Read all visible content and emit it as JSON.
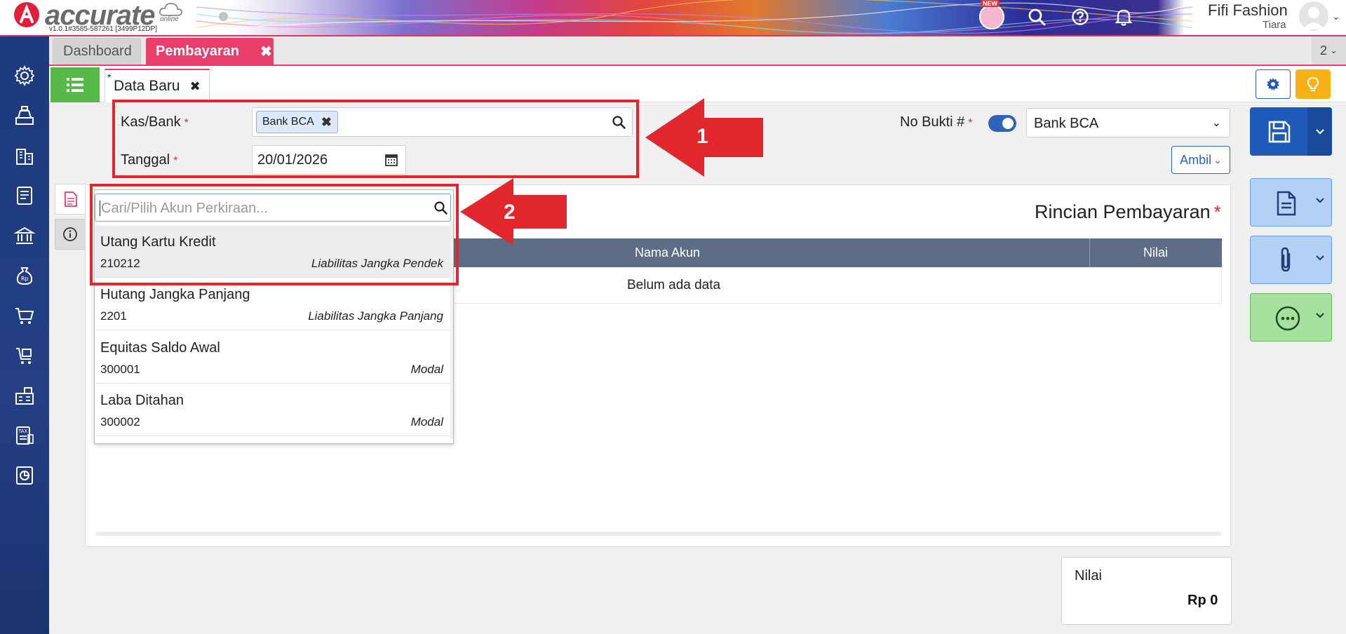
{
  "app": {
    "logo_text": "accurate",
    "logo_sub": "online",
    "version": "v1.0.1#3585-587261 [3499P12DP]",
    "new_badge": "NEW"
  },
  "user": {
    "company": "Fifi Fashion",
    "name": "Tiara"
  },
  "tabs": [
    {
      "label": "Dashboard",
      "active": false
    },
    {
      "label": "Pembayaran",
      "active": true,
      "close": "✖"
    }
  ],
  "tab_count": "2",
  "subtab": {
    "marker": "*",
    "label": "Data Baru",
    "close": "✖"
  },
  "form": {
    "kas_label": "Kas/Bank",
    "kas_value": "Bank BCA",
    "tanggal_label": "Tanggal",
    "tanggal_value": "20/01/2026",
    "required_mark": "*",
    "nobukti_label": "No Bukti #",
    "nobukti_value": "Bank BCA",
    "ambil_label": "Ambil"
  },
  "panel": {
    "title": "Rincian Pembayaran",
    "columns": [
      "Nama Akun",
      "Nilai"
    ],
    "empty_text": "Belum ada data"
  },
  "dropdown": {
    "placeholder": "Cari/Pilih Akun Perkiraan...",
    "items": [
      {
        "name": "Utang Kartu Kredit",
        "code": "210212",
        "type": "Liabilitas Jangka Pendek",
        "selected": true
      },
      {
        "name": "Hutang Jangka Panjang",
        "code": "2201",
        "type": "Liabilitas Jangka Panjang",
        "selected": false
      },
      {
        "name": "Equitas Saldo Awal",
        "code": "300001",
        "type": "Modal",
        "selected": false
      },
      {
        "name": "Laba Ditahan",
        "code": "300002",
        "type": "Modal",
        "selected": false
      }
    ]
  },
  "annotations": {
    "one": "1",
    "two": "2"
  },
  "total": {
    "label": "Nilai",
    "value": "Rp 0"
  },
  "colors": {
    "accent_pink": "#e93e6a",
    "brand_blue": "#1e5bb8",
    "sidebar": "#1d3a7e",
    "annotation_red": "#e2262d",
    "green": "#56b948",
    "orange": "#f7b218"
  }
}
